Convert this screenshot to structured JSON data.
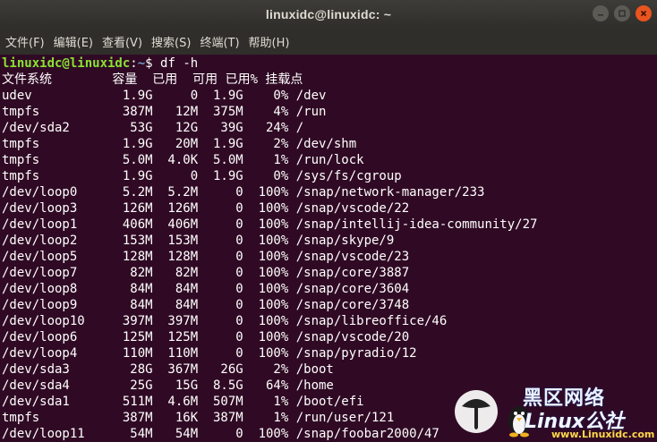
{
  "window": {
    "title": "linuxidc@linuxidc: ~"
  },
  "menubar": {
    "items": [
      {
        "label": "文件(F)"
      },
      {
        "label": "编辑(E)"
      },
      {
        "label": "查看(V)"
      },
      {
        "label": "搜索(S)"
      },
      {
        "label": "终端(T)"
      },
      {
        "label": "帮助(H)"
      }
    ]
  },
  "terminal": {
    "prompt": {
      "user_host": "linuxidc@linuxidc",
      "colon": ":",
      "path": "~",
      "symbol": "$ ",
      "command": "df -h"
    },
    "lines": [
      "文件系统        容量  已用  可用 已用% 挂载点",
      "udev            1.9G     0  1.9G    0% /dev",
      "tmpfs           387M   12M  375M    4% /run",
      "/dev/sda2        53G   12G   39G   24% /",
      "tmpfs           1.9G   20M  1.9G    2% /dev/shm",
      "tmpfs           5.0M  4.0K  5.0M    1% /run/lock",
      "tmpfs           1.9G     0  1.9G    0% /sys/fs/cgroup",
      "/dev/loop0      5.2M  5.2M     0  100% /snap/network-manager/233",
      "/dev/loop3      126M  126M     0  100% /snap/vscode/22",
      "/dev/loop1      406M  406M     0  100% /snap/intellij-idea-community/27",
      "/dev/loop2      153M  153M     0  100% /snap/skype/9",
      "/dev/loop5      128M  128M     0  100% /snap/vscode/23",
      "/dev/loop7       82M   82M     0  100% /snap/core/3887",
      "/dev/loop8       84M   84M     0  100% /snap/core/3604",
      "/dev/loop9       84M   84M     0  100% /snap/core/3748",
      "/dev/loop10     397M  397M     0  100% /snap/libreoffice/46",
      "/dev/loop6      125M  125M     0  100% /snap/vscode/20",
      "/dev/loop4      110M  110M     0  100% /snap/pyradio/12",
      "/dev/sda3        28G  367M   26G    2% /boot",
      "/dev/sda4        25G   15G  8.5G   64% /home",
      "/dev/sda1       511M  4.6M  507M    1% /boot/efi",
      "tmpfs           387M   16K  387M    1% /run/user/121",
      "/dev/loop11      54M   54M     0  100% /snap/foobar2000/47"
    ]
  },
  "watermark": {
    "cjk": "黑区网络",
    "brand": "Linux",
    "brand_suffix": "公社",
    "url": "www.Linuxidc.com"
  },
  "colors": {
    "terminal_bg": "#300a24",
    "prompt_user": "#8ae234",
    "prompt_path": "#729fcf",
    "close_button": "#e9541f"
  },
  "icons": {
    "minimize": "minimize-icon",
    "maximize": "maximize-icon",
    "close": "close-icon",
    "logo": "linux-penguin-logo"
  }
}
